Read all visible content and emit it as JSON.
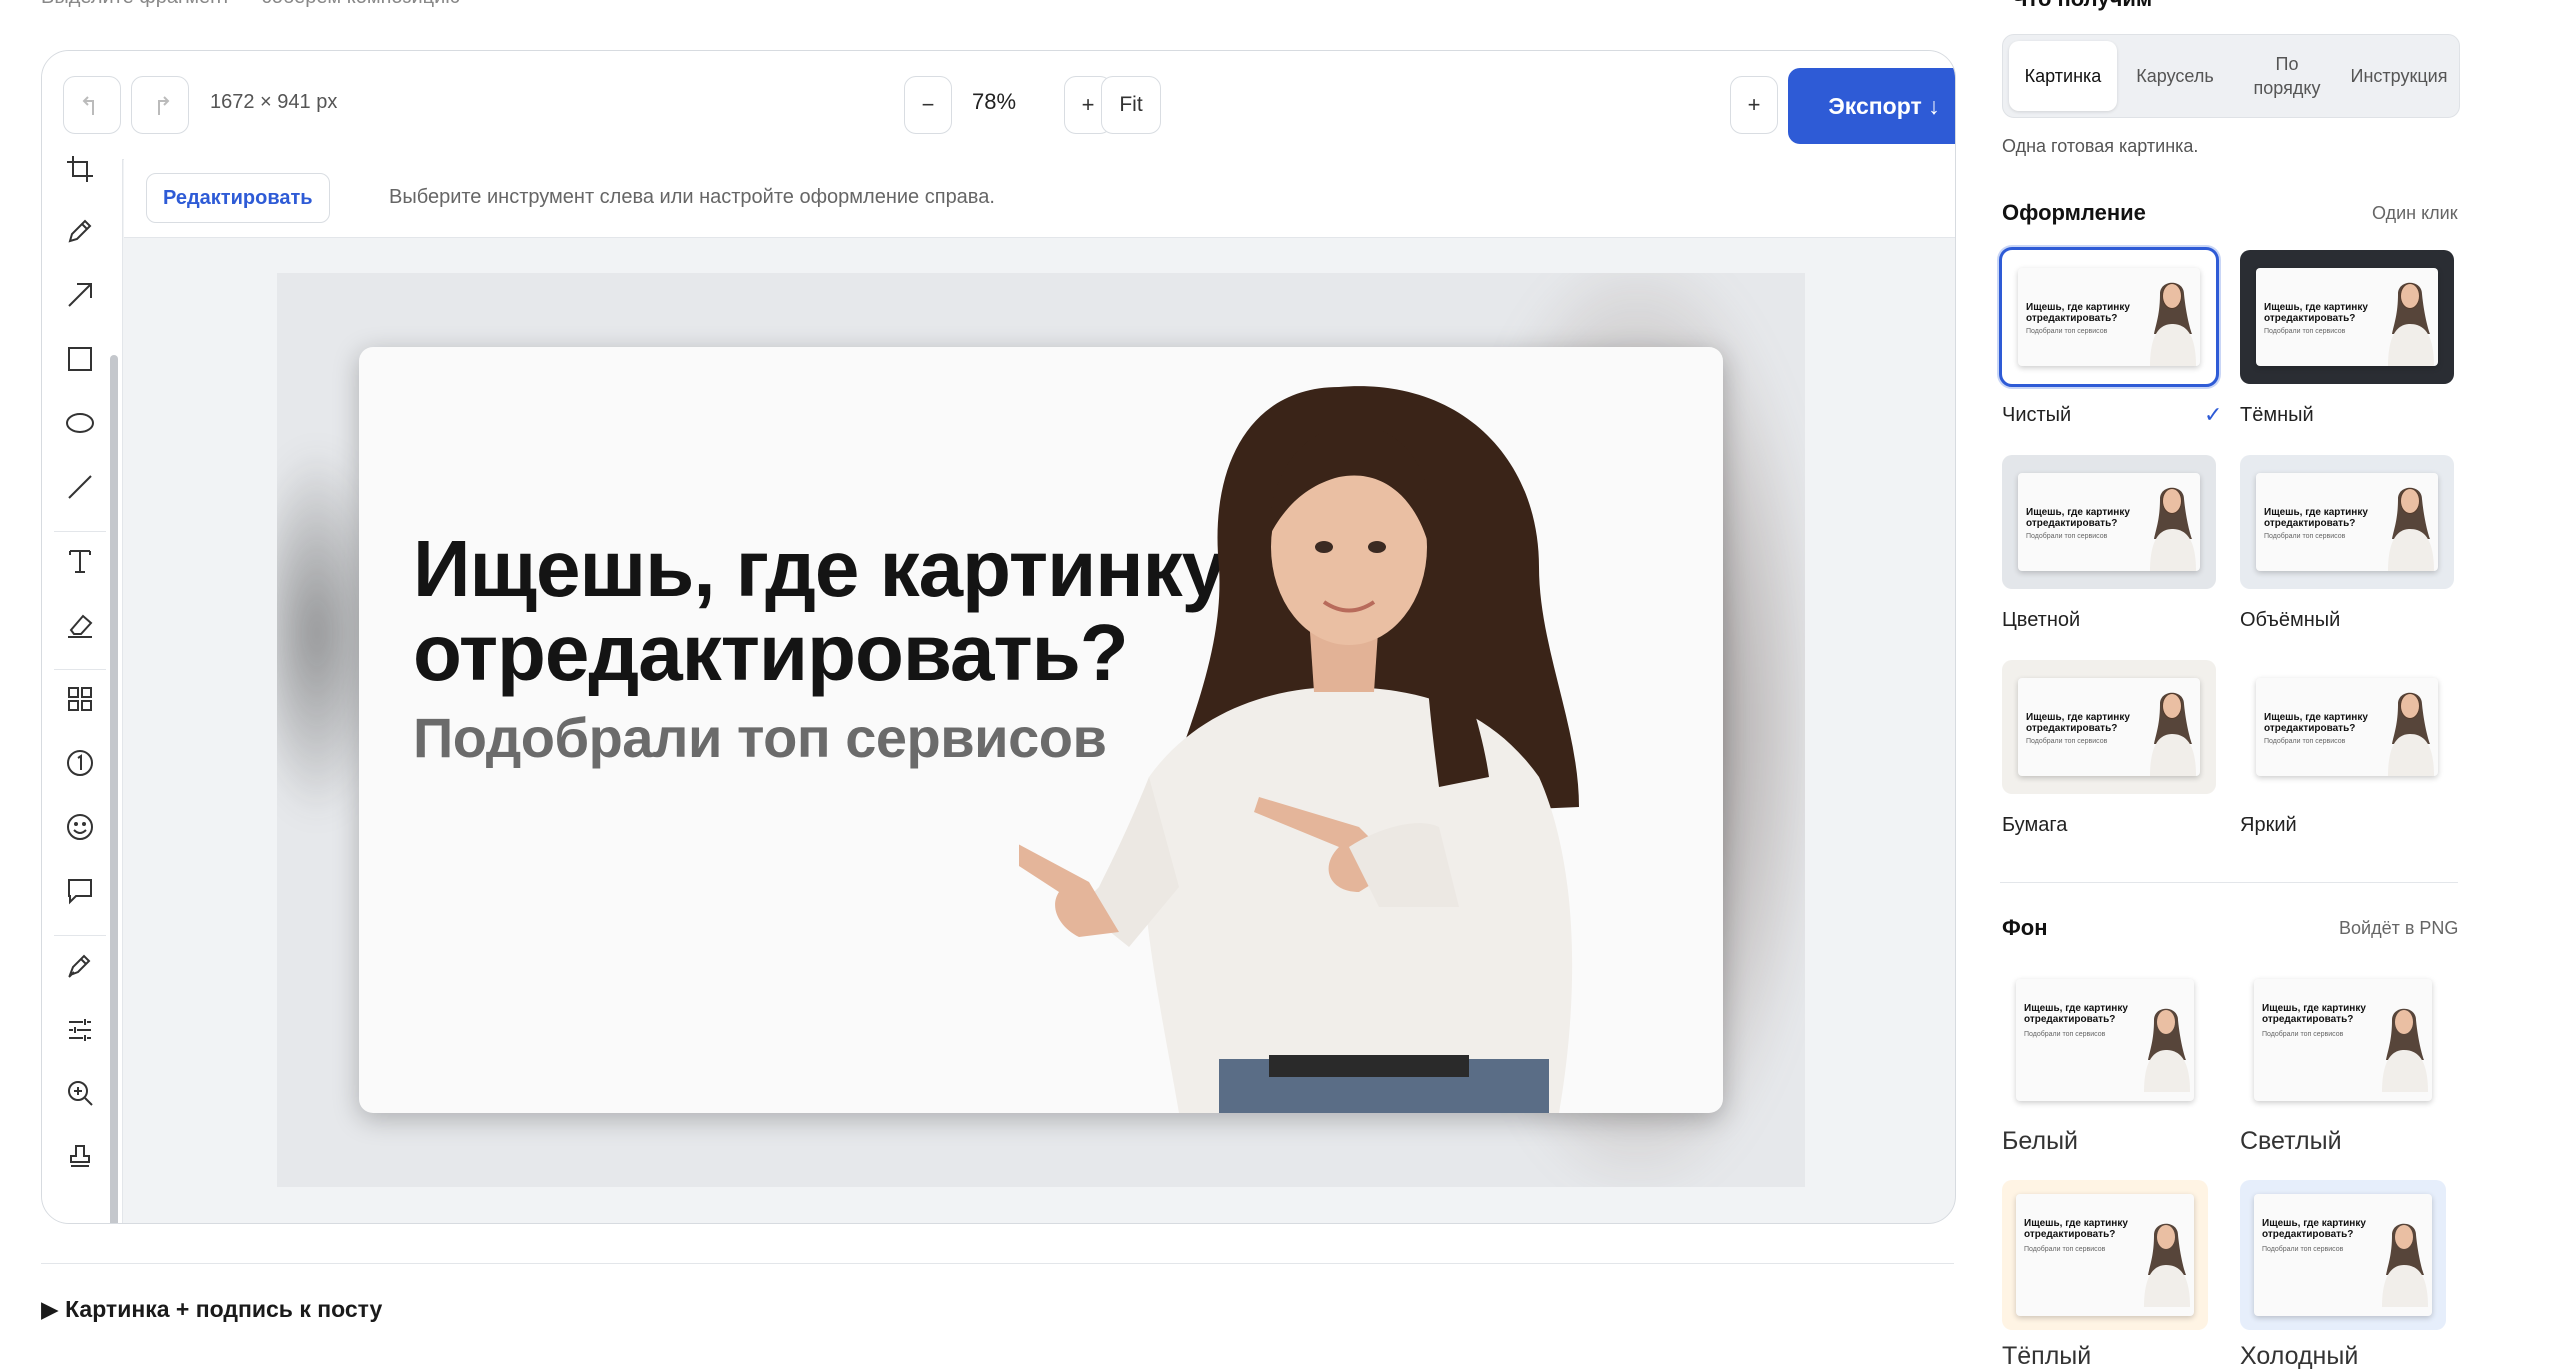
{
  "top_cut": {
    "left": "Выделите фрагмент — соберём композицию",
    "right": "Что получим"
  },
  "toolbar": {
    "undo_icon": "undo-icon",
    "redo_icon": "redo-icon",
    "dimensions": "1672 × 941 px",
    "zoom_out": "−",
    "zoom_value": "78%",
    "zoom_in": "+",
    "fit": "Fit",
    "add": "+",
    "export": "Экспорт ↓"
  },
  "edit_row": {
    "edit_button": "Редактировать",
    "hint": "Выберите инструмент слева или настройте оформление справа."
  },
  "tools": [
    "crop-icon",
    "pencil-icon",
    "arrow-icon",
    "rectangle-icon",
    "ellipse-icon",
    "line-icon",
    "text-icon",
    "eraser-icon",
    "grid-icon",
    "number-icon",
    "emoji-icon",
    "comment-icon",
    "pen-icon",
    "adjust-icon",
    "zoom-icon",
    "stamp-icon"
  ],
  "canvas": {
    "headline_1": "Ищешь, где картинку",
    "headline_2": "отредактировать?",
    "subhead": "Подобрали топ сервисов"
  },
  "caption": "▶ Картинка + подпись к посту",
  "panel": {
    "tabs": [
      "Картинка",
      "Карусель",
      "По порядку",
      "Инструкция"
    ],
    "tab_active": "Картинка",
    "tab_desc": "Одна готовая картинка.",
    "style_title": "Оформление",
    "style_hint": "Один клик",
    "styles": [
      "Чистый",
      "Тёмный",
      "Цветной",
      "Объёмный",
      "Бумага",
      "Яркий"
    ],
    "style_selected": "Чистый",
    "check": "✓",
    "bg_title": "Фон",
    "bg_hint": "Войдёт в PNG",
    "backgrounds": [
      "Белый",
      "Светлый",
      "Тёплый",
      "Холодный"
    ],
    "thumb_title": "Ищешь, где картинку отредактировать?",
    "thumb_sub": "Подобрали топ сервисов"
  },
  "colors": {
    "accent": "#2e5bd6",
    "canvas_bg": "#e6e8eb"
  }
}
